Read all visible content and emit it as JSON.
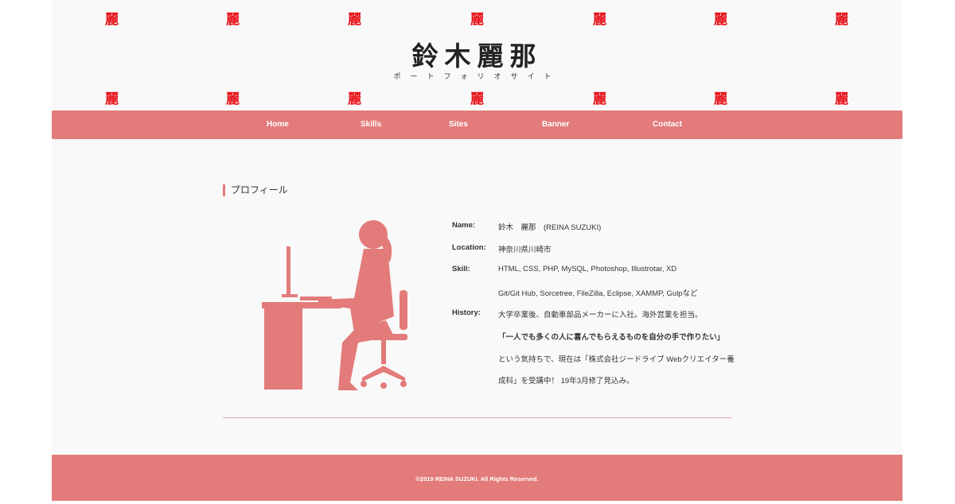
{
  "header": {
    "deco_char": "麗",
    "title": "鈴木麗那",
    "subtitle": "ポートフォリオサイト"
  },
  "nav": [
    "Home",
    "Skills",
    "Sites",
    "Banner",
    "Contact"
  ],
  "section": {
    "title": "プロフィール"
  },
  "profile": [
    {
      "key": "Name:",
      "value": "鈴木　麗那　(REINA SUZUKI)"
    },
    {
      "key": "Location:",
      "value": "神奈川県川崎市"
    },
    {
      "key": "Skill:",
      "value": "HTML, CSS, PHP, MySQL, Photoshop, Illustrotar, XD"
    },
    {
      "key": "",
      "value": "Git/Git Hub, Sorcetree, FileZilla, Eclipse, XAMMP, Gulpなど"
    },
    {
      "key": "History:",
      "value": "大学卒業後、自動車部品メーカーに入社。海外営業を担当。"
    },
    {
      "key": "",
      "value": "「一人でも多くの人に喜んでもらえるものを自分の手で作りたい」"
    },
    {
      "key": "",
      "value": "という気持ちで、現在は「株式会社ジードライブ Webクリエイター養"
    },
    {
      "key": "",
      "value": "成科」を受講中！ 19年3月修了見込み。"
    }
  ],
  "footer": "©2019 REINA SUZUKI. All Rights Reserved.",
  "colors": {
    "accent": "#e27b7a",
    "deco": "#e8141c"
  }
}
